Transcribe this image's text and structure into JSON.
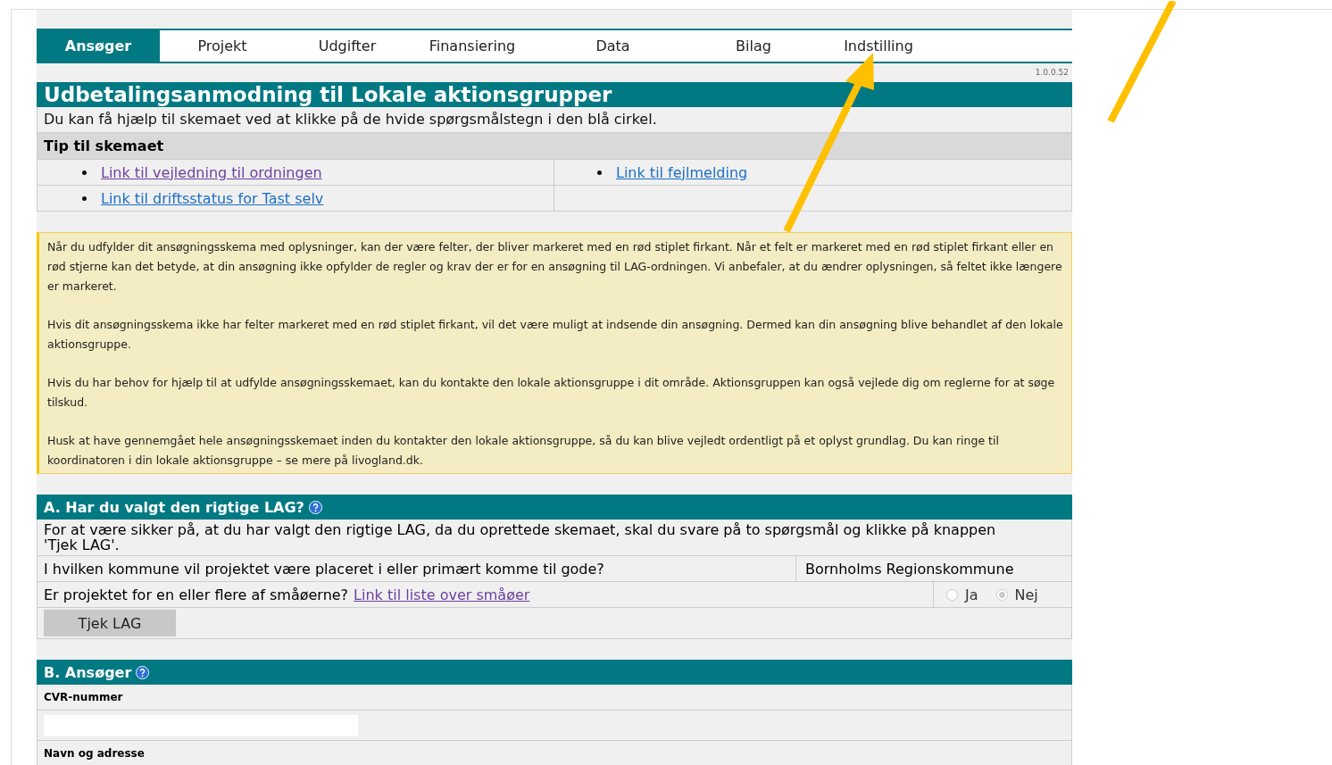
{
  "tabs": [
    {
      "label": "Ansøger",
      "selected": true
    },
    {
      "label": "Projekt",
      "selected": false
    },
    {
      "label": "Udgifter",
      "selected": false
    },
    {
      "label": "Finansiering",
      "selected": false
    },
    {
      "label": "Data",
      "selected": false
    },
    {
      "label": "Bilag",
      "selected": false
    },
    {
      "label": "Indstilling",
      "selected": false
    }
  ],
  "version": "1.0.0.52",
  "header": {
    "title": "Udbetalingsanmodning til Lokale aktionsgrupper",
    "help_text": "Du kan få hjælp til skemaet ved at klikke på de hvide spørgsmålstegn i den blå cirkel."
  },
  "tips": {
    "title": "Tip til skemaet",
    "rows": [
      [
        {
          "text": "Link til vejledning til ordningen",
          "visited": true
        },
        {
          "text": "Link til fejlmelding",
          "visited": false
        }
      ],
      [
        {
          "text": "Link til driftsstatus for Tast selv",
          "visited": false
        }
      ]
    ]
  },
  "notice": {
    "paragraphs": [
      "Når du udfylder dit ansøgningsskema med oplysninger, kan der være felter, der bliver markeret med en rød stiplet firkant. Når et felt er markeret med en rød stiplet firkant eller en rød stjerne kan det betyde, at din ansøgning ikke opfylder de regler og krav der er for en ansøgning til LAG-ordningen. Vi anbefaler, at du ændrer oplysningen, så feltet ikke længere er markeret.",
      "Hvis dit ansøgningsskema ikke har felter markeret med en rød stiplet firkant, vil det være muligt at indsende din ansøgning. Dermed kan din ansøgning blive behandlet af den lokale aktionsgruppe.",
      "Hvis du har behov for hjælp til at udfylde ansøgningsskemaet, kan du kontakte den lokale aktionsgruppe i dit område. Aktionsgruppen kan også vejlede dig om reglerne for at søge tilskud.",
      "Husk at have gennemgået hele ansøgningsskemaet inden du kontakter den lokale aktionsgruppe, så du kan blive vejledt ordentligt på et oplyst grundlag. Du kan ringe til koordinatoren i din lokale aktionsgruppe – se mere på livogland.dk."
    ]
  },
  "section_a": {
    "title": "A. Har du valgt den rigtige LAG?",
    "intro": "For at være sikker på, at du har valgt den rigtige LAG, da du oprettede skemaet, skal du svare på to spørgsmål og klikke på knappen 'Tjek LAG'.",
    "questions": [
      {
        "kind": "value",
        "label": "I hvilken kommune vil projektet være placeret i eller primært komme til gode?",
        "value": "Bornholms Regionskommune"
      },
      {
        "kind": "radio",
        "label": "Er projektet for en eller flere af småøerne?",
        "link": {
          "text": "Link til liste over småøer",
          "visited": true
        },
        "options": [
          {
            "label": "Ja",
            "selected": false
          },
          {
            "label": "Nej",
            "selected": true
          }
        ]
      }
    ],
    "button": "Tjek LAG"
  },
  "section_b": {
    "title": "B. Ansøger",
    "fields": [
      {
        "label": "CVR-nummer",
        "kind": "input"
      },
      {
        "label": "Navn og adresse",
        "kind": "label"
      }
    ]
  }
}
